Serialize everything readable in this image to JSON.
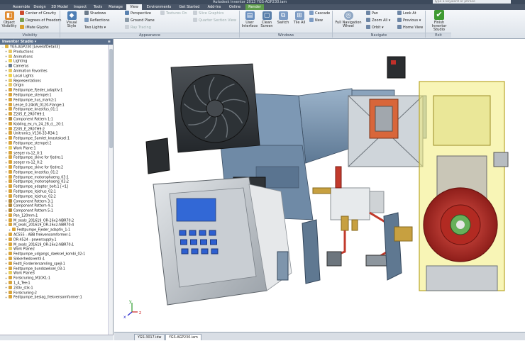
{
  "window": {
    "title": "Autodesk Inventor 2013 YGS-AGP230.iam",
    "search_placeholder": "Type a keyword or phrase"
  },
  "ribbon_tabs": [
    "Assemble",
    "Design",
    "3D Model",
    "Inspect",
    "Tools",
    "Manage",
    "View",
    "Environments",
    "Get Started",
    "Add-Ins",
    "Online",
    "Render"
  ],
  "active_tab": "View",
  "ribbon": {
    "object_visibility": "Object Visibility",
    "center_of_gravity": "Center of Gravity",
    "degrees_of_freedom": "Degrees of Freedom",
    "imate_glyphs": "iMate Glyphs",
    "visual_style": "Visual Style",
    "shadows": "Shadows",
    "reflections": "Reflections",
    "two_lights": "Two Lights",
    "perspective": "Perspective",
    "ground_plane": "Ground Plane",
    "textures_on": "Textures On",
    "ray_tracing": "Ray Tracing",
    "slice_graphics": "Slice Graphics",
    "quarter_section_view": "Quarter Section View",
    "user_interface": "User Interface",
    "clean_screen": "Clean Screen",
    "switch": "Switch",
    "tile_all": "Tile All",
    "cascade": "Cascade",
    "new": "New",
    "full_navigation_wheel": "Full Navigation Wheel",
    "pan": "Pan",
    "zoom_all": "Zoom All",
    "orbit": "Orbit",
    "look_at": "Look At",
    "previous": "Previous",
    "home_view": "Home View",
    "finish_inventor_studio": "Finish Inventor Studio",
    "groups": {
      "visibility": "Visibility",
      "appearance": "Appearance",
      "windows": "Windows",
      "navigate": "Navigate",
      "exit": "Exit"
    }
  },
  "browser": {
    "title": "Inventor Studio",
    "items": [
      {
        "label": "YGS-AGP230 [LevelofDetail3]",
        "depth": 0,
        "icon": "assembly"
      },
      {
        "label": "Productions",
        "depth": 1,
        "icon": "folder"
      },
      {
        "label": "Animations",
        "depth": 1,
        "icon": "folder"
      },
      {
        "label": "Lighting",
        "depth": 1,
        "icon": "light"
      },
      {
        "label": "Cameras",
        "depth": 1,
        "icon": "camera"
      },
      {
        "label": "Animation Favorites",
        "depth": 1,
        "icon": "folder"
      },
      {
        "label": "Local Lights",
        "depth": 1,
        "icon": "light"
      },
      {
        "label": "Representations",
        "depth": 1,
        "icon": "folder"
      },
      {
        "label": "Origin",
        "depth": 1,
        "icon": "folder"
      },
      {
        "label": "Fedtpumpe_Fjeder_adaptiv:1",
        "depth": 1,
        "icon": "part"
      },
      {
        "label": "Fedtpumpe_stempel:1",
        "depth": 1,
        "icon": "part"
      },
      {
        "label": "Fedtpumpe_hus_mark2:1",
        "depth": 1,
        "icon": "part"
      },
      {
        "label": "Lenze_0.24kW_0120-Flange:1",
        "depth": 1,
        "icon": "part"
      },
      {
        "label": "Fedtpumpe_knastfus_01:1",
        "depth": 1,
        "icon": "part"
      },
      {
        "label": "Z205_E_2R07H9:1",
        "depth": 1,
        "icon": "part"
      },
      {
        "label": "Component Pattern 1:1",
        "depth": 1,
        "icon": "pattern"
      },
      {
        "label": "Kobling_ex_m_24_28_d__20:1",
        "depth": 1,
        "icon": "part"
      },
      {
        "label": "Z205_E_2R07H9:2",
        "depth": 1,
        "icon": "part"
      },
      {
        "label": "Unitronics_V130-33-R34:1",
        "depth": 1,
        "icon": "part"
      },
      {
        "label": "Fedtpumpe_Samlet_knastaksel:1",
        "depth": 1,
        "icon": "part"
      },
      {
        "label": "Fedtpumpe_stempel:2",
        "depth": 1,
        "icon": "part"
      },
      {
        "label": "Work Plane:1",
        "depth": 1,
        "icon": "plane"
      },
      {
        "label": "seeger ra-12_0:1",
        "depth": 1,
        "icon": "part"
      },
      {
        "label": "Fedtpumpe_skive for fjedre:1",
        "depth": 1,
        "icon": "part"
      },
      {
        "label": "seeger ra-12_0:2",
        "depth": 1,
        "icon": "part"
      },
      {
        "label": "Fedtpumpe_skive for fjedre:2",
        "depth": 1,
        "icon": "part"
      },
      {
        "label": "Fedtpumpe_knastfus_01:2",
        "depth": 1,
        "icon": "part"
      },
      {
        "label": "Fedtpumpe_motorophaeng_03:1",
        "depth": 1,
        "icon": "part"
      },
      {
        "label": "Fedtpumpe_motorophaeng_03:2",
        "depth": 1,
        "icon": "part"
      },
      {
        "label": "Fedtpumpe_adapter_bolt:1 [<1]",
        "depth": 1,
        "icon": "part"
      },
      {
        "label": "Fedtpumpe_lejehus_02:1",
        "depth": 1,
        "icon": "part"
      },
      {
        "label": "Fedtpumpe_lejehus_02:2",
        "depth": 1,
        "icon": "part"
      },
      {
        "label": "Component Pattern 3:1",
        "depth": 1,
        "icon": "pattern"
      },
      {
        "label": "Component Pattern 4:1",
        "depth": 1,
        "icon": "pattern"
      },
      {
        "label": "Component Pattern 5:1",
        "depth": 1,
        "icon": "pattern"
      },
      {
        "label": "Pen_120mm:1",
        "depth": 1,
        "icon": "part"
      },
      {
        "label": "M_seals_201619_OR-26x2-NBR70:2",
        "depth": 1,
        "icon": "part"
      },
      {
        "label": "M_seals_201619_OR-26x2-NBR70:4",
        "depth": 1,
        "icon": "part"
      },
      {
        "label": "Fedtpumpe_Fjeder_adaptiv_1:1",
        "depth": 2,
        "icon": "part"
      },
      {
        "label": "AC555 - ABB frekvensomformer:1",
        "depth": 1,
        "icon": "part"
      },
      {
        "label": "DR-4524 - powersupply:1",
        "depth": 1,
        "icon": "part"
      },
      {
        "label": "M_seals_201619_OR-26x2-NBR70:1",
        "depth": 1,
        "icon": "part"
      },
      {
        "label": "Work Plane2",
        "depth": 1,
        "icon": "plane"
      },
      {
        "label": "Fedtpumpe_udgangs_daeksel_kombi_02:1",
        "depth": 1,
        "icon": "part"
      },
      {
        "label": "Sikkerhedsventil:1",
        "depth": 1,
        "icon": "part"
      },
      {
        "label": "Fedtl_Forderlersamling_spejl:1",
        "depth": 1,
        "icon": "part"
      },
      {
        "label": "Fedtpumpe_bundsaeksel_03:1",
        "depth": 1,
        "icon": "part"
      },
      {
        "label": "Work Plane3",
        "depth": 1,
        "icon": "plane"
      },
      {
        "label": "Forskruning_M10X1:1",
        "depth": 1,
        "icon": "part"
      },
      {
        "label": "1_4_Tee:1",
        "depth": 1,
        "icon": "part"
      },
      {
        "label": "230v_stik:1",
        "depth": 1,
        "icon": "part"
      },
      {
        "label": "Forskruning:2",
        "depth": 1,
        "icon": "part"
      },
      {
        "label": "Fedtpumpe_beslag_frekvensomformer:1",
        "depth": 1,
        "icon": "part"
      }
    ]
  },
  "document_tabs": [
    "YGS-3017.idw",
    "YGS-AGP230.iam"
  ],
  "active_document_tab": "YGS-AGP230.iam",
  "axis_labels": {
    "x": "x",
    "y": "y",
    "z": "z"
  },
  "colors": {
    "ribbon_dark": "#4a5668",
    "render_tab": "#5d9b4a",
    "browser_header": "#5a6f8c",
    "finish_green": "#3f9a32",
    "pump_red": "#c0302a",
    "housing_yellow": "#e8e070",
    "motor_blue": "#6f8aa6"
  }
}
